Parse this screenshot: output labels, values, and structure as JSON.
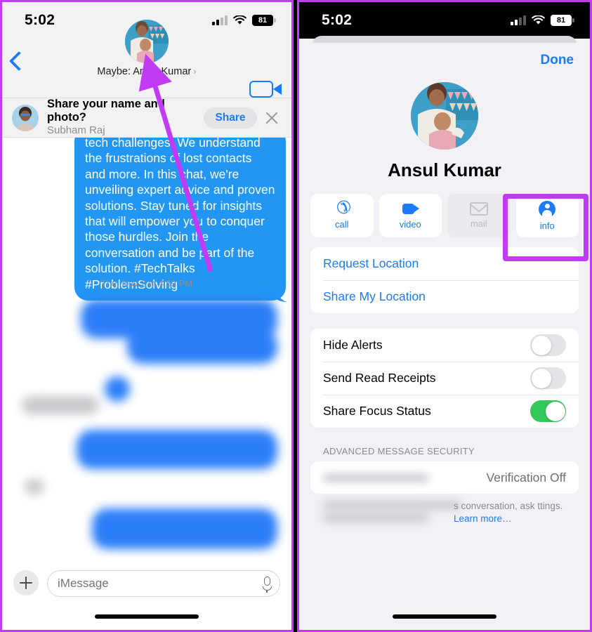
{
  "status_bar": {
    "time": "5:02",
    "battery": "81",
    "cellular_icon": "cellular-bars-icon",
    "wifi_icon": "wifi-icon",
    "battery_icon": "battery-icon"
  },
  "left_phone": {
    "header": {
      "back_icon": "back-chevron-icon",
      "contact_name": "Maybe: Ansul Kumar",
      "name_chevron": "›",
      "video_icon": "video-camera-icon"
    },
    "share_banner": {
      "title": "Share your name and photo?",
      "subtitle": "Subham Raj",
      "share_label": "Share",
      "close_icon": "close-x-icon",
      "avatar": "contact-avatar"
    },
    "conversation": {
      "message_text": "tech challenges! We understand the frustrations of lost contacts and more. In this chat, we're unveiling expert advice and proven solutions. Stay tuned for insights that will empower you to conquer those hurdles. Join the conversation and be part of the solution. #TechTalks #ProblemSolving",
      "timestamp": "Thu, Nov 2 at 4:59 PM"
    },
    "input_bar": {
      "add_icon": "plus-icon",
      "placeholder": "iMessage",
      "value": "",
      "mic_icon": "microphone-icon"
    }
  },
  "right_phone": {
    "sheet": {
      "done_label": "Done",
      "profile_name": "Ansul Kumar",
      "profile_avatar": "contact-photo",
      "actions": [
        {
          "label": "call",
          "icon": "phone-icon",
          "enabled": true
        },
        {
          "label": "video",
          "icon": "video-camera-icon",
          "enabled": true
        },
        {
          "label": "mail",
          "icon": "envelope-icon",
          "enabled": false
        },
        {
          "label": "info",
          "icon": "person-circle-icon",
          "enabled": true
        }
      ],
      "location_links": [
        "Request Location",
        "Share My Location"
      ],
      "toggles": [
        {
          "label": "Hide Alerts",
          "on": false
        },
        {
          "label": "Send Read Receipts",
          "on": false
        },
        {
          "label": "Share Focus Status",
          "on": true
        }
      ],
      "security": {
        "section_title": "ADVANCED MESSAGE SECURITY",
        "verification_status": "Verification Off",
        "footer_text_visible": "s conversation, ask ttings.",
        "learn_more": "Learn more…"
      }
    }
  },
  "annotations": {
    "arrow_color": "#c13bf5",
    "highlight_color": "#c13bf5",
    "highlight_target": "info"
  }
}
